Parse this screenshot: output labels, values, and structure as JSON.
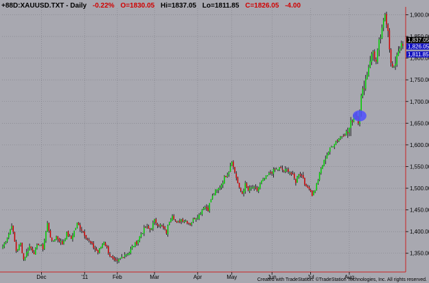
{
  "header": {
    "symbol": "+88D:XAUUSD.TXT - Daily",
    "change_pct": "-0.22%",
    "open": "O=1830.05",
    "high": "Hi=1837.05",
    "low": "Lo=1811.85",
    "close": "C=1826.05",
    "change": "-4.00"
  },
  "footer": {
    "credit": "Created with TradeStation. ©TradeStation Technologies, Inc. All rights reserved."
  },
  "price_markers": [
    {
      "label": "1,837.05",
      "value": 1837.05,
      "color": "#000000"
    },
    {
      "label": "1,826.05",
      "value": 1826.05,
      "color": "#1010c0"
    },
    {
      "label": "1,811.85",
      "value": 1811.85,
      "color": "#1010c0"
    }
  ],
  "colors": {
    "background": "#a8a8b0",
    "up": "#00cc00",
    "down": "#cc0000",
    "grid": "#7c7c84",
    "axis": "#cc2020",
    "ellipse": "#5050ff",
    "header_black": "#000000",
    "header_red": "#d00000"
  },
  "chart_data": {
    "type": "candlestick",
    "title": "+88D:XAUUSD.TXT - Daily",
    "ylim": [
      1310,
      1915
    ],
    "y_ticks": [
      1350,
      1400,
      1450,
      1500,
      1550,
      1600,
      1650,
      1700,
      1750,
      1800,
      1850,
      1900
    ],
    "y_tick_labels": [
      "1,350.00",
      "1,400.00",
      "1,450.00",
      "1,500.00",
      "1,550.00",
      "1,600.00",
      "1,650.00",
      "1,700.00",
      "1,750.00",
      "1,800.00",
      "1,850.00",
      "1,900.00"
    ],
    "x_labels": [
      {
        "label": "Dec",
        "bar": 26
      },
      {
        "label": "'11",
        "bar": 55
      },
      {
        "label": "Feb",
        "bar": 77
      },
      {
        "label": "Mar",
        "bar": 102
      },
      {
        "label": "Apr",
        "bar": 131
      },
      {
        "label": "May",
        "bar": 154
      },
      {
        "label": "Jun",
        "bar": 181
      },
      {
        "label": "Jul",
        "bar": 207
      },
      {
        "label": "Aug",
        "bar": 233
      }
    ],
    "grid": true,
    "annotation": {
      "type": "ellipse",
      "bar": 239,
      "price": 1667,
      "color": "#5050ff"
    },
    "keypoints": [
      [
        0,
        1365
      ],
      [
        4,
        1395
      ],
      [
        6,
        1416
      ],
      [
        9,
        1356
      ],
      [
        12,
        1372
      ],
      [
        14,
        1336
      ],
      [
        18,
        1366
      ],
      [
        21,
        1352
      ],
      [
        24,
        1372
      ],
      [
        27,
        1362
      ],
      [
        30,
        1418
      ],
      [
        33,
        1375
      ],
      [
        36,
        1388
      ],
      [
        40,
        1372
      ],
      [
        43,
        1395
      ],
      [
        46,
        1384
      ],
      [
        50,
        1418
      ],
      [
        53,
        1405
      ],
      [
        56,
        1388
      ],
      [
        60,
        1368
      ],
      [
        64,
        1352
      ],
      [
        68,
        1378
      ],
      [
        72,
        1345
      ],
      [
        75,
        1330
      ],
      [
        77,
        1330
      ],
      [
        79,
        1338
      ],
      [
        82,
        1348
      ],
      [
        85,
        1352
      ],
      [
        87,
        1365
      ],
      [
        90,
        1375
      ],
      [
        93,
        1395
      ],
      [
        96,
        1410
      ],
      [
        99,
        1404
      ],
      [
        102,
        1425
      ],
      [
        104,
        1418
      ],
      [
        107,
        1412
      ],
      [
        110,
        1398
      ],
      [
        112,
        1425
      ],
      [
        114,
        1440
      ],
      [
        117,
        1418
      ],
      [
        120,
        1428
      ],
      [
        123,
        1425
      ],
      [
        126,
        1418
      ],
      [
        129,
        1432
      ],
      [
        132,
        1438
      ],
      [
        135,
        1458
      ],
      [
        138,
        1452
      ],
      [
        140,
        1475
      ],
      [
        143,
        1492
      ],
      [
        146,
        1502
      ],
      [
        149,
        1524
      ],
      [
        152,
        1540
      ],
      [
        154,
        1565
      ],
      [
        155,
        1548
      ],
      [
        157,
        1525
      ],
      [
        159,
        1498
      ],
      [
        161,
        1488
      ],
      [
        163,
        1508
      ],
      [
        165,
        1495
      ],
      [
        168,
        1502
      ],
      [
        171,
        1495
      ],
      [
        174,
        1515
      ],
      [
        177,
        1525
      ],
      [
        180,
        1536
      ],
      [
        183,
        1542
      ],
      [
        186,
        1546
      ],
      [
        189,
        1540
      ],
      [
        192,
        1542
      ],
      [
        195,
        1528
      ],
      [
        197,
        1515
      ],
      [
        199,
        1535
      ],
      [
        202,
        1525
      ],
      [
        204,
        1500
      ],
      [
        206,
        1502
      ],
      [
        208,
        1485
      ],
      [
        210,
        1498
      ],
      [
        212,
        1520
      ],
      [
        214,
        1545
      ],
      [
        216,
        1562
      ],
      [
        218,
        1578
      ],
      [
        220,
        1590
      ],
      [
        223,
        1605
      ],
      [
        226,
        1615
      ],
      [
        229,
        1625
      ],
      [
        232,
        1628
      ],
      [
        235,
        1660
      ],
      [
        237,
        1672
      ],
      [
        239,
        1658
      ],
      [
        241,
        1710
      ],
      [
        243,
        1738
      ],
      [
        245,
        1765
      ],
      [
        247,
        1798
      ],
      [
        249,
        1815
      ],
      [
        251,
        1790
      ],
      [
        253,
        1835
      ],
      [
        255,
        1862
      ],
      [
        257,
        1902
      ],
      [
        259,
        1868
      ],
      [
        261,
        1785
      ],
      [
        263,
        1772
      ],
      [
        265,
        1810
      ],
      [
        267,
        1828
      ],
      [
        269,
        1826
      ]
    ],
    "notes": "OHLC bars interpolated from keypoints [bar index, close] read off the chart."
  }
}
